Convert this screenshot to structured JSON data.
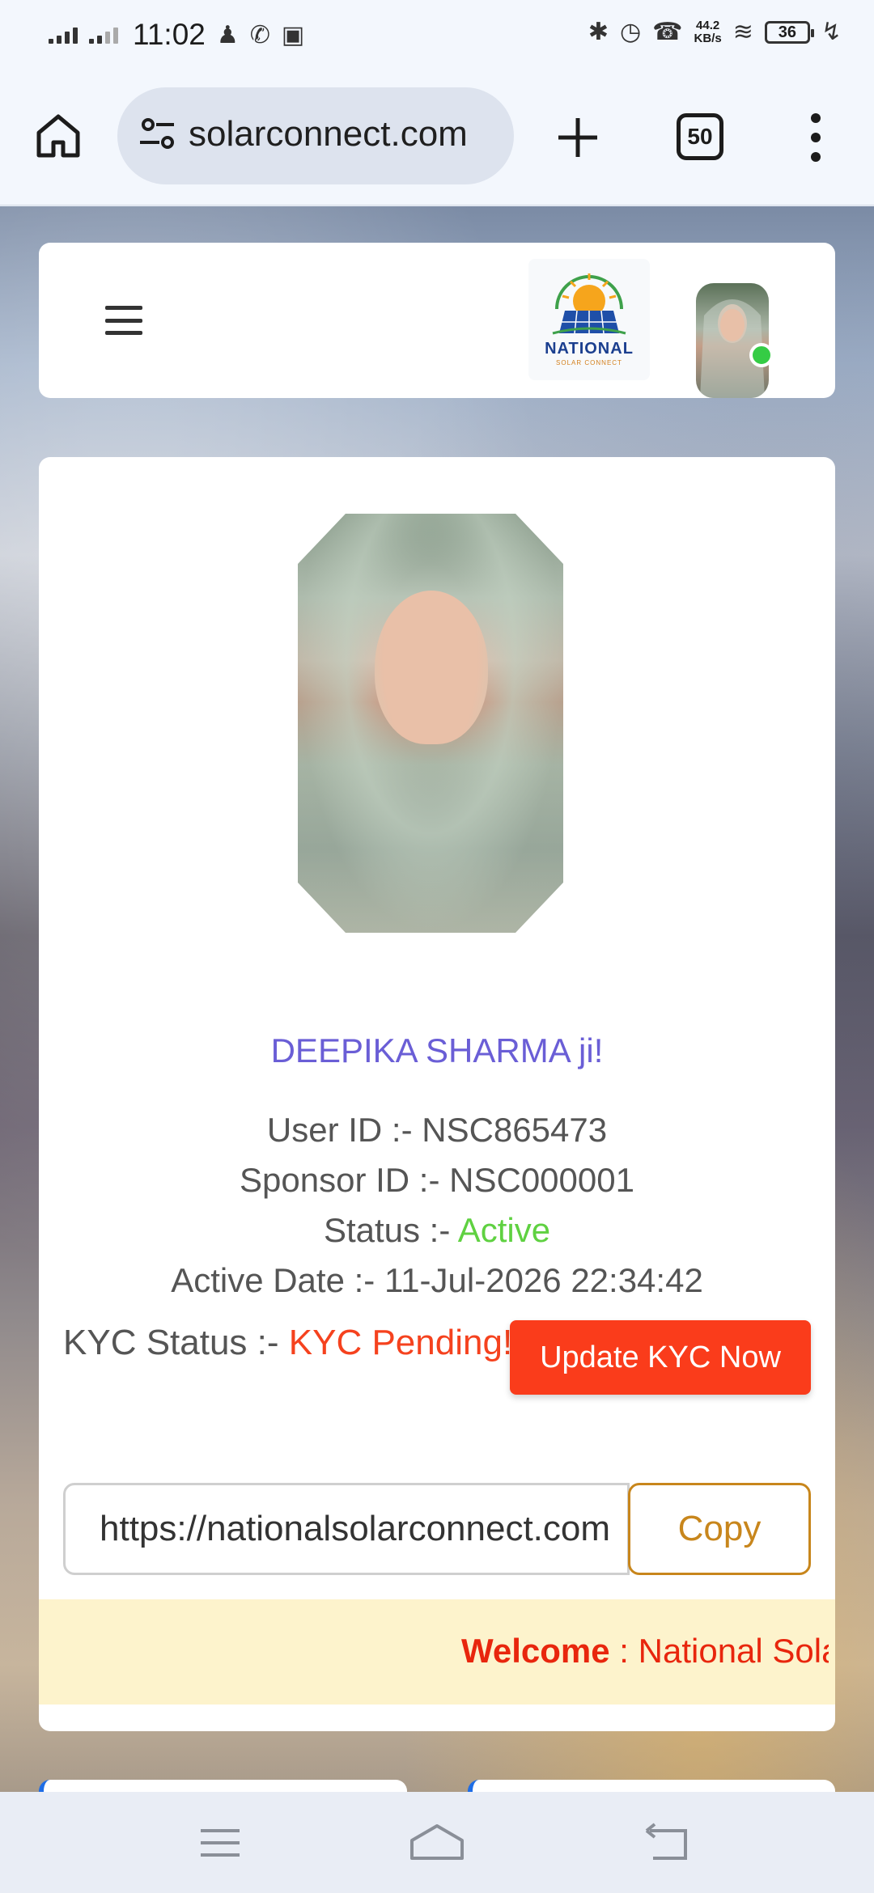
{
  "status_bar": {
    "time": "11:02",
    "net_speed_value": "44.2",
    "net_speed_unit": "KB/s",
    "battery": "36"
  },
  "browser": {
    "url": "solarconnect.com",
    "tab_count": "50"
  },
  "site": {
    "logo_title": "NATIONAL",
    "logo_subtitle": "SOLAR CONNECT"
  },
  "profile": {
    "name": "DEEPIKA SHARMA ji!",
    "user_id_label": "User ID :- ",
    "user_id": "NSC865473",
    "sponsor_id_label": "Sponsor ID :- ",
    "sponsor_id": "NSC000001",
    "status_label": "Status :- ",
    "status": "Active",
    "active_date_label": "Active Date :- ",
    "active_date": "11-Jul-2026 22:34:42",
    "kyc_label": "KYC Status :- ",
    "kyc_status": "KYC Pending!",
    "kyc_button": "Update KYC Now"
  },
  "referral": {
    "link": "https://nationalsolarconnect.com",
    "copy_label": "Copy"
  },
  "marquee": {
    "bold": "Welcome",
    "text": " : National Solar Connect"
  },
  "colors": {
    "name": "#6a5ed6",
    "status_active": "#5fd141",
    "kyc_pending": "#f5421e",
    "kyc_button": "#fa3c1b",
    "copy_accent": "#c8861c",
    "marquee_bg": "#fdf3cc",
    "online": "#35cc45"
  },
  "icons": [
    "home-icon",
    "tune-icon",
    "plus-icon",
    "tabs-icon",
    "more-vert-icon",
    "hamburger-icon",
    "recents-icon",
    "nav-home-icon",
    "back-icon"
  ]
}
